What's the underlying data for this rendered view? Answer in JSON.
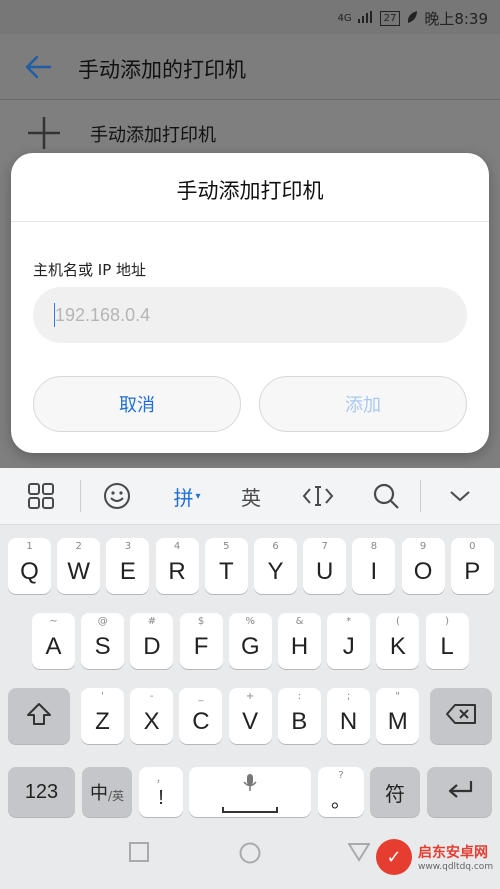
{
  "status_bar": {
    "signal": "4G",
    "battery": "27",
    "time": "晚上8:39"
  },
  "app_bar": {
    "title": "手动添加的打印机"
  },
  "add_row": {
    "label": "手动添加打印机"
  },
  "dialog": {
    "title": "手动添加打印机",
    "field_label": "主机名或 IP 地址",
    "field_value": "",
    "field_placeholder": "192.168.0.4",
    "cancel_label": "取消",
    "add_label": "添加"
  },
  "keyboard": {
    "toolbar": {
      "pinyin": "拼",
      "english": "英"
    },
    "row1": [
      {
        "hint": "1",
        "key": "Q"
      },
      {
        "hint": "2",
        "key": "W"
      },
      {
        "hint": "3",
        "key": "E"
      },
      {
        "hint": "4",
        "key": "R"
      },
      {
        "hint": "5",
        "key": "T"
      },
      {
        "hint": "6",
        "key": "Y"
      },
      {
        "hint": "7",
        "key": "U"
      },
      {
        "hint": "8",
        "key": "I"
      },
      {
        "hint": "9",
        "key": "O"
      },
      {
        "hint": "0",
        "key": "P"
      }
    ],
    "row2": [
      {
        "hint": "~",
        "key": "A"
      },
      {
        "hint": "@",
        "key": "S"
      },
      {
        "hint": "#",
        "key": "D"
      },
      {
        "hint": "$",
        "key": "F"
      },
      {
        "hint": "%",
        "key": "G"
      },
      {
        "hint": "&",
        "key": "H"
      },
      {
        "hint": "*",
        "key": "J"
      },
      {
        "hint": "(",
        "key": "K"
      },
      {
        "hint": ")",
        "key": "L"
      }
    ],
    "row3": [
      {
        "hint": "'",
        "key": "Z"
      },
      {
        "hint": "-",
        "key": "X"
      },
      {
        "hint": "_",
        "key": "C"
      },
      {
        "hint": "+",
        "key": "V"
      },
      {
        "hint": ":",
        "key": "B"
      },
      {
        "hint": ";",
        "key": "N"
      },
      {
        "hint": "\"",
        "key": "M"
      }
    ],
    "bottom": {
      "num": "123",
      "lang_main": "中",
      "lang_sub": "/英",
      "punct_hint": "，",
      "punct_key": "!",
      "q_hint": "?",
      "q_key": "。",
      "symbols": "符"
    }
  },
  "watermark": {
    "title": "启东安卓网",
    "url": "www.qdltdq.com"
  }
}
